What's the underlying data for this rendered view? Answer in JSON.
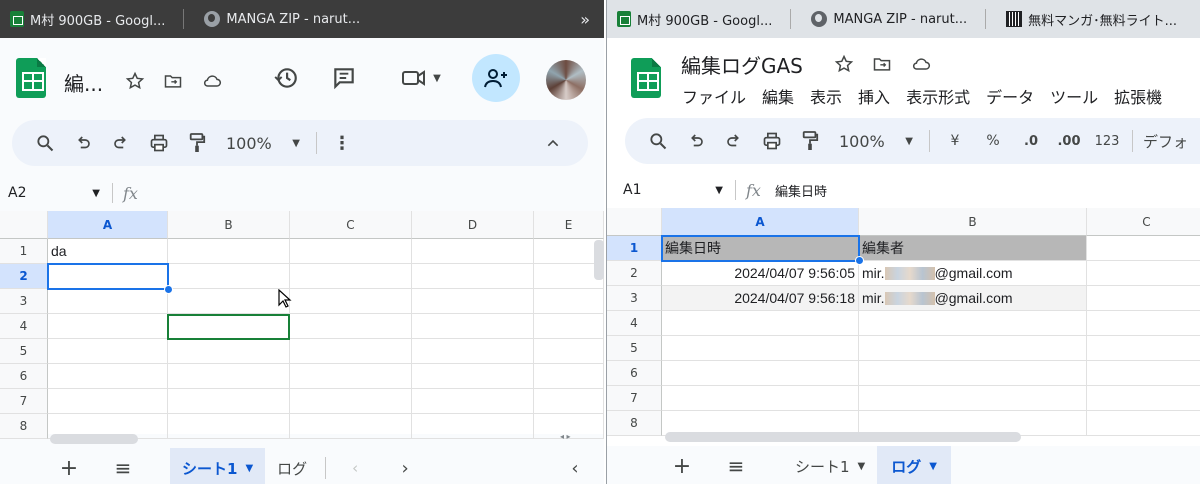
{
  "left": {
    "tabs": [
      {
        "title": "M村 900GB - Googl...",
        "icon": "sheets-favicon"
      },
      {
        "title": "MANGA ZIP - narut...",
        "icon": "globe-favicon"
      }
    ],
    "more_tabs": "»",
    "doc_title": "編...",
    "toolbar": {
      "zoom": "100%"
    },
    "namebox": "A2",
    "columns": [
      "A",
      "B",
      "C",
      "D",
      "E"
    ],
    "rows": [
      "1",
      "2",
      "3",
      "4",
      "5",
      "6",
      "7",
      "8"
    ],
    "cells": {
      "A1": "da"
    },
    "sheet_tabs": [
      {
        "label": "シート1",
        "active": true
      },
      {
        "label": "ログ",
        "active": false
      }
    ]
  },
  "right": {
    "tabs": [
      {
        "title": "M村 900GB - Googl...",
        "icon": "sheets-favicon"
      },
      {
        "title": "MANGA ZIP - narut...",
        "icon": "globe-favicon"
      },
      {
        "title": "無料マンガ･無料ライト...",
        "icon": "barcode-favicon"
      }
    ],
    "doc_title": "編集ログGAS",
    "menu": [
      "ファイル",
      "編集",
      "表示",
      "挿入",
      "表示形式",
      "データ",
      "ツール",
      "拡張機"
    ],
    "toolbar": {
      "zoom": "100%",
      "currency": "¥",
      "percent": "%",
      "dec_less": ".0",
      "dec_more": ".00",
      "number_fmt": "123",
      "font": "デフォ"
    },
    "namebox": "A1",
    "formula": "編集日時",
    "columns": [
      "A",
      "B",
      "C"
    ],
    "rows": [
      "1",
      "2",
      "3",
      "4",
      "5",
      "6",
      "7",
      "8"
    ],
    "table": [
      [
        "編集日時",
        "編集者"
      ],
      [
        "2024/04/07 9:56:05",
        "mir.",
        "@gmail.com"
      ],
      [
        "2024/04/07 9:56:18",
        "mir.",
        "@gmail.com"
      ]
    ],
    "sheet_tabs": [
      {
        "label": "シート1",
        "active": false
      },
      {
        "label": "ログ",
        "active": true
      }
    ]
  }
}
